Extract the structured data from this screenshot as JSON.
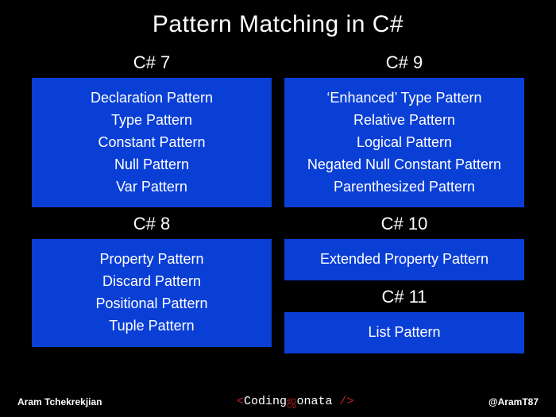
{
  "title": "Pattern Matching in C#",
  "columns": [
    {
      "sections": [
        {
          "title": "C# 7",
          "items": [
            "Declaration Pattern",
            "Type Pattern",
            "Constant Pattern",
            "Null Pattern",
            "Var Pattern"
          ]
        },
        {
          "title": "C# 8",
          "items": [
            "Property Pattern",
            "Discard Pattern",
            "Positional Pattern",
            "Tuple Pattern"
          ]
        }
      ]
    },
    {
      "sections": [
        {
          "title": "C# 9",
          "items": [
            "‘Enhanced’ Type Pattern",
            "Relative Pattern",
            "Logical Pattern",
            "Negated Null Constant Pattern",
            "Parenthesized Pattern"
          ]
        },
        {
          "title": "C# 10",
          "items": [
            "Extended Property Pattern"
          ]
        },
        {
          "title": "C# 11",
          "items": [
            "List Pattern"
          ]
        }
      ]
    }
  ],
  "footer": {
    "author": "Aram Tchekrekjian",
    "brand": {
      "open": "<",
      "name_a": "Coding",
      "sep_glyph": "ஜ",
      "name_b": "onata",
      "slash": " /",
      "close": ">"
    },
    "handle": "@AramT87"
  },
  "colors": {
    "bg": "#000000",
    "box": "#0a3fd6",
    "brand_red": "#c62020"
  }
}
